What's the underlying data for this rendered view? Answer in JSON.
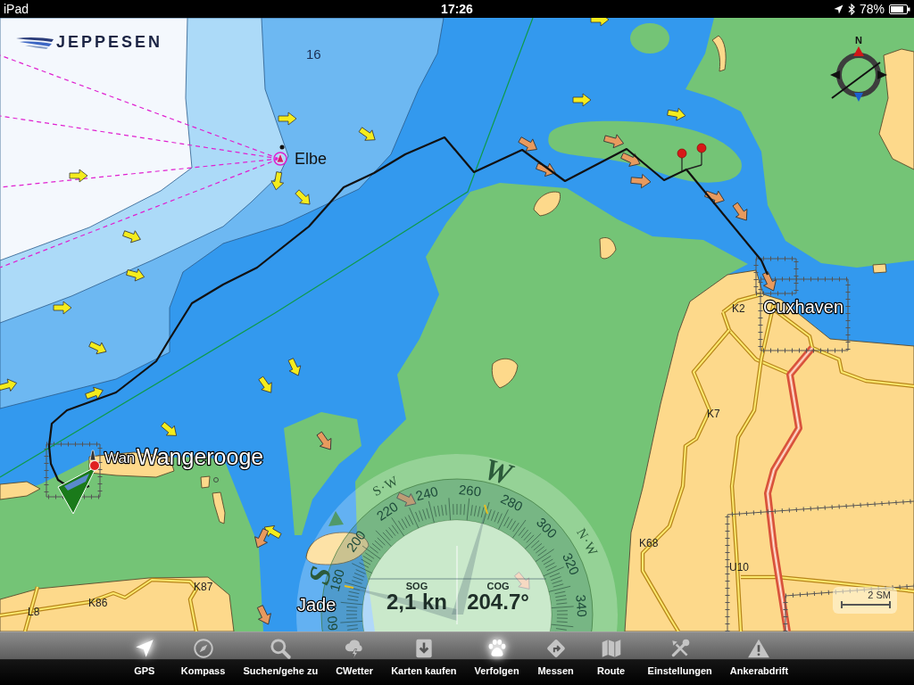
{
  "status_bar": {
    "device": "iPad",
    "time": "17:26",
    "battery": "78%"
  },
  "logo": {
    "brand": "JEPPESEN"
  },
  "map": {
    "labels": [
      {
        "text": "16",
        "kind": "depth"
      },
      {
        "text": "Elbe",
        "kind": "plain"
      },
      {
        "text": "Cuxhaven",
        "kind": "town"
      },
      {
        "text": "K2",
        "kind": "road"
      },
      {
        "text": "K7",
        "kind": "road"
      },
      {
        "text": "Wan",
        "kind": "town-minor"
      },
      {
        "text": "Wangerooge",
        "kind": "town"
      },
      {
        "text": "K68",
        "kind": "road"
      },
      {
        "text": "U10",
        "kind": "road"
      },
      {
        "text": "K87",
        "kind": "road"
      },
      {
        "text": "K86",
        "kind": "road"
      },
      {
        "text": "Jade",
        "kind": "town"
      },
      {
        "text": "L8",
        "kind": "road"
      }
    ],
    "north_indicator": {
      "label": "N"
    },
    "scale": {
      "label": "2 SM"
    }
  },
  "compass": {
    "cardinals": [
      "S",
      "S·W",
      "W",
      "N·W"
    ],
    "degrees": [
      "60",
      "180",
      "200",
      "220",
      "240",
      "260",
      "280",
      "300",
      "320",
      "340"
    ],
    "sog": {
      "label": "SOG",
      "value": "2,1 kn"
    },
    "cog": {
      "label": "COG",
      "value": "204.7°"
    }
  },
  "toolbar": [
    {
      "label": "GPS",
      "on": true
    },
    {
      "label": "Kompass",
      "on": false
    },
    {
      "label": "Suchen/gehe zu",
      "on": false
    },
    {
      "label": "CWetter",
      "on": false
    },
    {
      "label": "Karten kaufen",
      "on": false
    },
    {
      "label": "Verfolgen",
      "on": true
    },
    {
      "label": "Messen",
      "on": false
    },
    {
      "label": "Route",
      "on": false
    },
    {
      "label": "Einstellungen",
      "on": false
    },
    {
      "label": "Ankerabdrift",
      "on": false
    }
  ]
}
